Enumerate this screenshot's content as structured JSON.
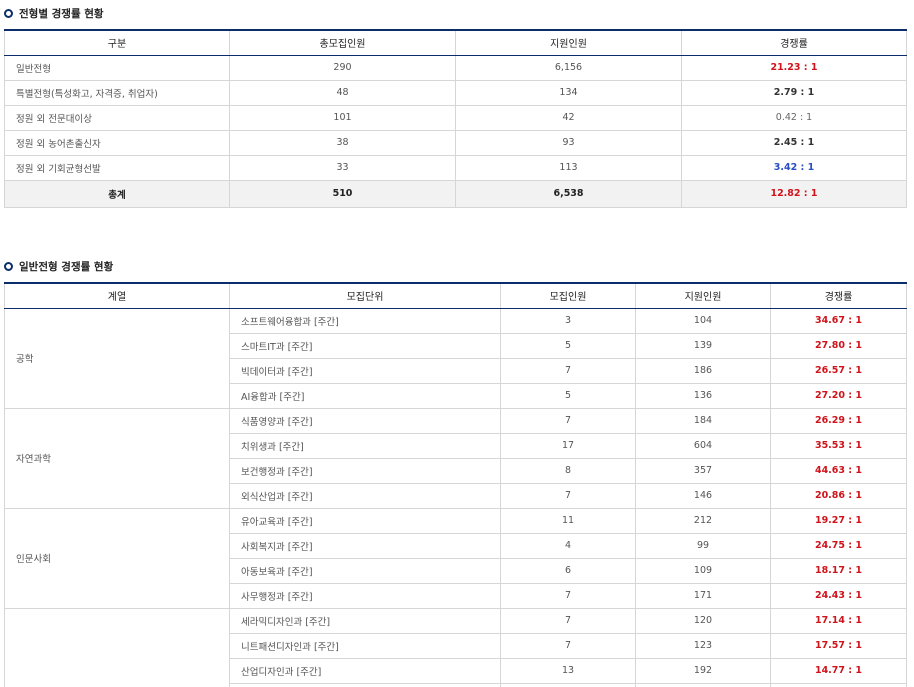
{
  "section1": {
    "title": "전형별 경쟁률 현황",
    "headers": [
      "구분",
      "총모집인원",
      "지원인원",
      "경쟁률"
    ],
    "rows": [
      {
        "name": "일반전형",
        "recruit": "290",
        "apply": "6,156",
        "rate": "21.23 : 1",
        "style": "red"
      },
      {
        "name": "특별전형(특성화고, 자격증, 취업자)",
        "recruit": "48",
        "apply": "134",
        "rate": "2.79 : 1",
        "style": "dark"
      },
      {
        "name": "정원 외 전문대이상",
        "recruit": "101",
        "apply": "42",
        "rate": "0.42 : 1",
        "style": "plain"
      },
      {
        "name": "정원 외 농어촌출신자",
        "recruit": "38",
        "apply": "93",
        "rate": "2.45 : 1",
        "style": "dark"
      },
      {
        "name": "정원 외 기회균형선발",
        "recruit": "33",
        "apply": "113",
        "rate": "3.42 : 1",
        "style": "blue"
      }
    ],
    "total": {
      "name": "총계",
      "recruit": "510",
      "apply": "6,538",
      "rate": "12.82 : 1"
    }
  },
  "section2": {
    "title": "일반전형 경쟁률 현황",
    "headers": [
      "계열",
      "모집단위",
      "모집인원",
      "지원인원",
      "경쟁률"
    ],
    "groups": [
      {
        "name": "공학",
        "rows": [
          {
            "unit": "소프트웨어융합과 [주간]",
            "recruit": "3",
            "apply": "104",
            "rate": "34.67 : 1"
          },
          {
            "unit": "스마트IT과 [주간]",
            "recruit": "5",
            "apply": "139",
            "rate": "27.80 : 1"
          },
          {
            "unit": "빅데이터과 [주간]",
            "recruit": "7",
            "apply": "186",
            "rate": "26.57 : 1"
          },
          {
            "unit": "AI융합과 [주간]",
            "recruit": "5",
            "apply": "136",
            "rate": "27.20 : 1"
          }
        ]
      },
      {
        "name": "자연과학",
        "rows": [
          {
            "unit": "식품영양과 [주간]",
            "recruit": "7",
            "apply": "184",
            "rate": "26.29 : 1"
          },
          {
            "unit": "치위생과 [주간]",
            "recruit": "17",
            "apply": "604",
            "rate": "35.53 : 1"
          },
          {
            "unit": "보건행정과 [주간]",
            "recruit": "8",
            "apply": "357",
            "rate": "44.63 : 1"
          },
          {
            "unit": "외식산업과 [주간]",
            "recruit": "7",
            "apply": "146",
            "rate": "20.86 : 1"
          }
        ]
      },
      {
        "name": "인문사회",
        "rows": [
          {
            "unit": "유아교육과 [주간]",
            "recruit": "11",
            "apply": "212",
            "rate": "19.27 : 1"
          },
          {
            "unit": "사회복지과 [주간]",
            "recruit": "4",
            "apply": "99",
            "rate": "24.75 : 1"
          },
          {
            "unit": "아동보육과 [주간]",
            "recruit": "6",
            "apply": "109",
            "rate": "18.17 : 1"
          },
          {
            "unit": "사무행정과 [주간]",
            "recruit": "7",
            "apply": "171",
            "rate": "24.43 : 1"
          }
        ]
      },
      {
        "name": "",
        "rows": [
          {
            "unit": "세라믹디자인과 [주간]",
            "recruit": "7",
            "apply": "120",
            "rate": "17.14 : 1"
          },
          {
            "unit": "니트패션디자인과 [주간]",
            "recruit": "7",
            "apply": "123",
            "rate": "17.57 : 1"
          },
          {
            "unit": "산업디자인과 [주간]",
            "recruit": "13",
            "apply": "192",
            "rate": "14.77 : 1"
          },
          {
            "unit": "",
            "recruit": "",
            "apply": "",
            "rate": ""
          }
        ]
      }
    ]
  }
}
